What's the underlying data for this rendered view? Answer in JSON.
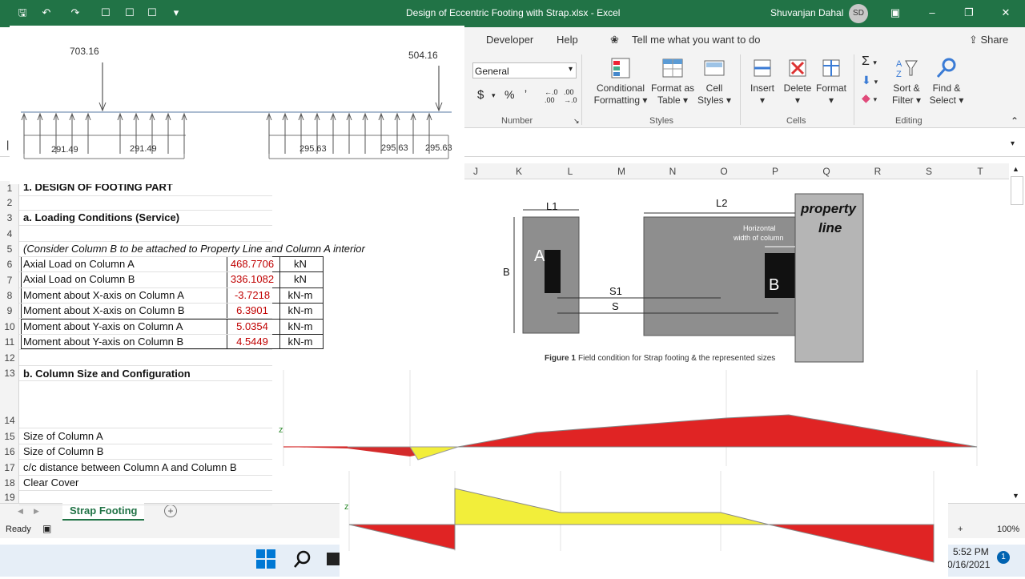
{
  "window": {
    "title": "Design of Eccentric Footing with Strap.xlsx  -  Excel",
    "user": "Shuvanjan Dahal",
    "user_initials": "SD"
  },
  "ribbon": {
    "tabs": [
      "Developer",
      "Help"
    ],
    "tell_me": "Tell me what you want to do",
    "share": "Share",
    "number_format": "General",
    "number_group": "Number",
    "styles_group": "Styles",
    "cells_group": "Cells",
    "editing_group": "Editing",
    "conditional_formatting": [
      "Conditional",
      "Formatting"
    ],
    "format_as_table": [
      "Format as",
      "Table"
    ],
    "cell_styles": [
      "Cell",
      "Styles"
    ],
    "insert": "Insert",
    "delete": "Delete",
    "format": "Format",
    "sort_filter": [
      "Sort &",
      "Filter"
    ],
    "find_select": [
      "Find &",
      "Select"
    ]
  },
  "columns": [
    "J",
    "K",
    "L",
    "M",
    "N",
    "O",
    "P",
    "Q",
    "R",
    "S",
    "T"
  ],
  "rows": [
    "1",
    "2",
    "3",
    "4",
    "5",
    "6",
    "7",
    "8",
    "9",
    "10",
    "11",
    "12",
    "13",
    "14",
    "15",
    "16",
    "17",
    "18",
    "19"
  ],
  "sheet": {
    "r1": "1. DESIGN OF FOOTING PART",
    "r3": "a. Loading Conditions (Service)",
    "r5": "(Consider Column B to be attached to Property Line and Column A interior",
    "table": [
      {
        "label": "Axial Load on Column A",
        "value": "468.7706",
        "unit": "kN"
      },
      {
        "label": "Axial Load on Column B",
        "value": "336.1082",
        "unit": "kN"
      },
      {
        "label": "Moment about X-axis on Column A",
        "value": "-3.7218",
        "unit": "kN-m"
      },
      {
        "label": "Moment about X-axis on Column B",
        "value": "6.3901",
        "unit": "kN-m"
      },
      {
        "label": "Moment about Y-axis on Column A",
        "value": "5.0354",
        "unit": "kN-m"
      },
      {
        "label": "Moment about Y-axis on Column B",
        "value": "4.5449",
        "unit": "kN-m"
      }
    ],
    "r13": "b. Column Size and Configuration",
    "r15": "Size of Column A",
    "r16": "Size of Column B",
    "r17": "c/c distance between Column A and Column B",
    "r18": "Clear Cover"
  },
  "sheet_tab": "Strap Footing",
  "status": {
    "ready": "Ready",
    "zoom": "100%"
  },
  "taskbar": {
    "time": "5:52 PM",
    "date": "0/16/2021",
    "notif": "1"
  },
  "load_diagram": {
    "load_a": "703.16",
    "load_b": "504.16",
    "pressures": [
      "291.49",
      "291.49",
      "295.63",
      "295.63",
      "295.63"
    ]
  },
  "figure1": {
    "l1": "L1",
    "l2": "L2",
    "b": "B",
    "s1": "S1",
    "s": "S",
    "col_a": "A",
    "col_b": "B",
    "horiz": [
      "Horizontal",
      "width of column"
    ],
    "property": [
      "property",
      "line"
    ],
    "caption_bold": "Figure 1",
    "caption": "Field condition for Strap footing & the represented sizes"
  }
}
